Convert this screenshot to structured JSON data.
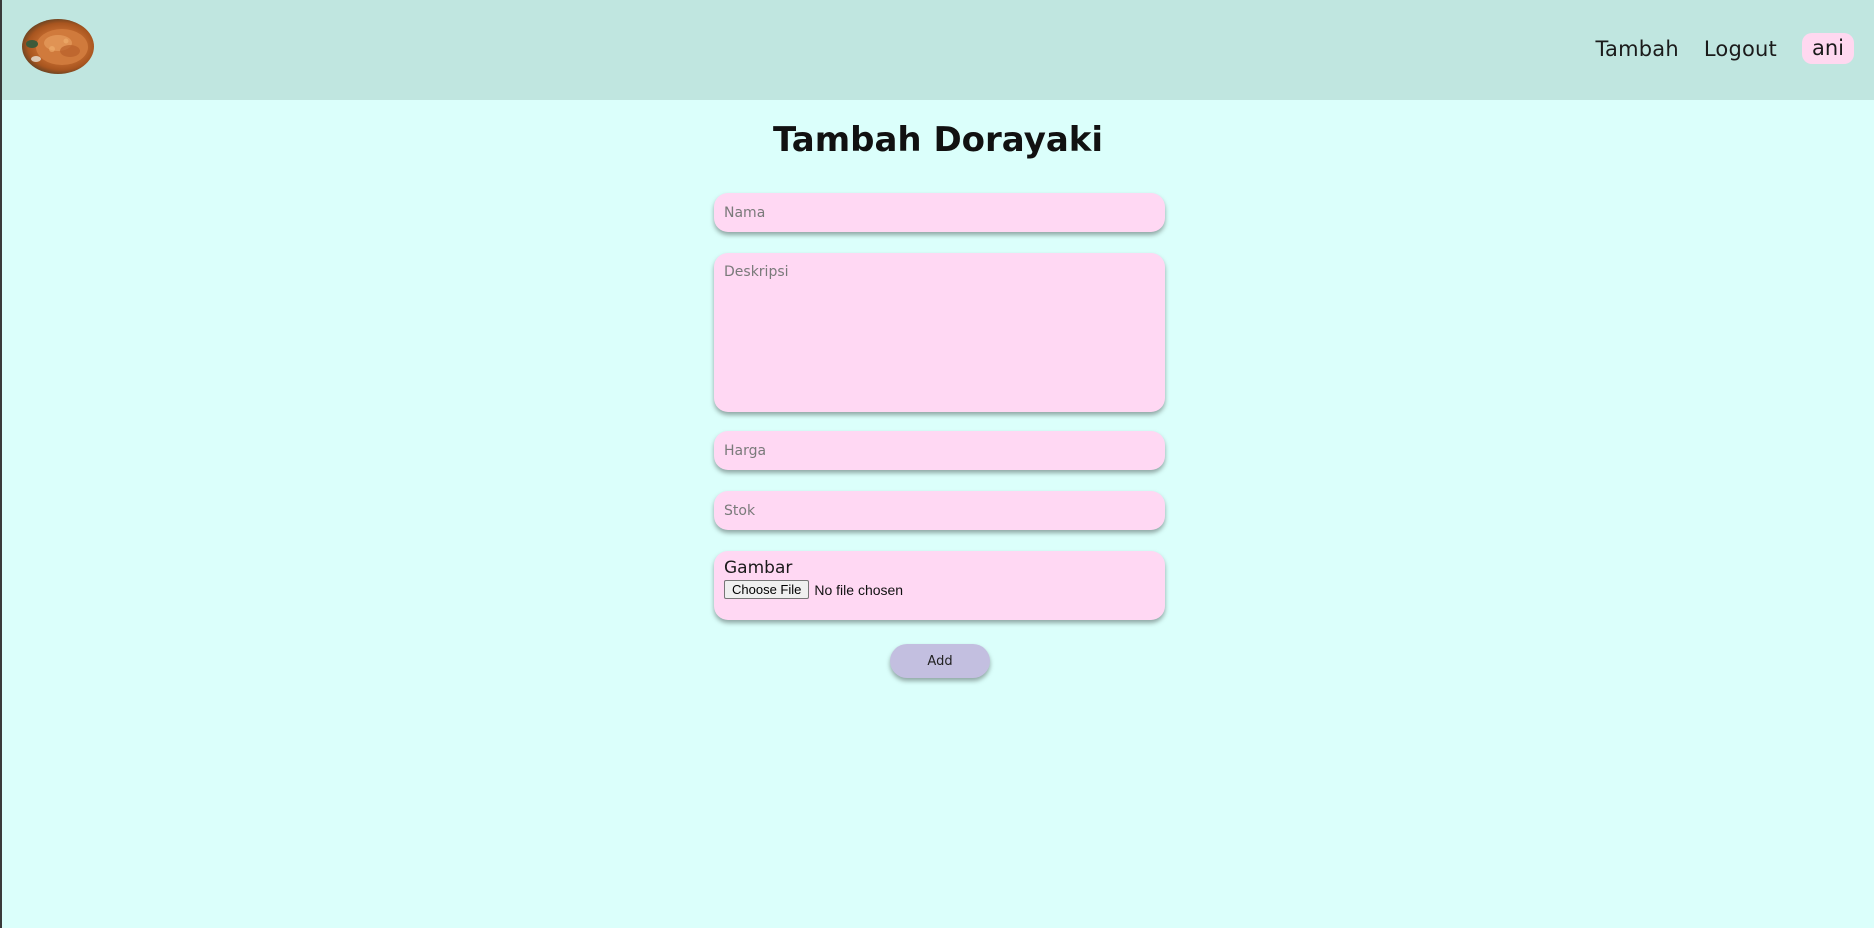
{
  "navbar": {
    "links": [
      "Tambah",
      "Logout"
    ],
    "user": "ani"
  },
  "page": {
    "title": "Tambah Dorayaki"
  },
  "form": {
    "nama_placeholder": "Nama",
    "deskripsi_placeholder": "Deskripsi",
    "harga_placeholder": "Harga",
    "stok_placeholder": "Stok",
    "gambar_label": "Gambar",
    "choose_file_label": "Choose File",
    "no_file_text": "No file chosen",
    "submit_label": "Add"
  },
  "colors": {
    "navbar_bg": "#c0e6e0",
    "page_bg": "#dbfffb",
    "field_bg": "#ffd8f3",
    "button_bg": "#c3bfe0",
    "user_badge_bg": "#ffd8f0"
  }
}
